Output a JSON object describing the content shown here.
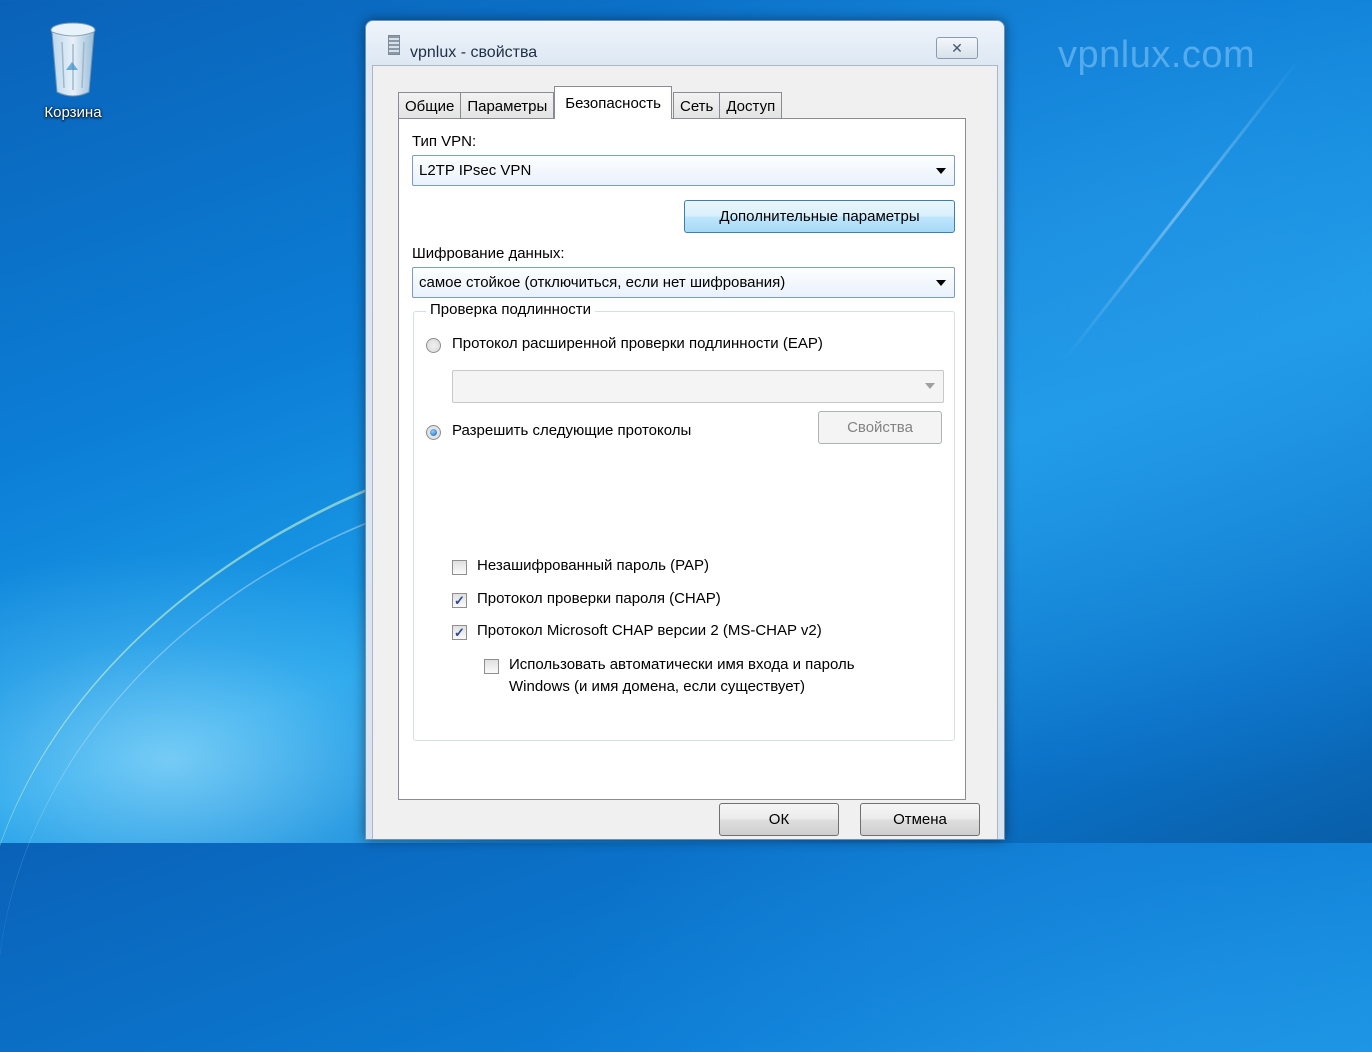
{
  "desktop": {
    "watermark": "vpnlux.com",
    "recycle_bin_label": "Корзина"
  },
  "window": {
    "title": "vpnlux - свойства",
    "close_glyph": "✕"
  },
  "tabs": [
    {
      "label": "Общие",
      "active": false
    },
    {
      "label": "Параметры",
      "active": false
    },
    {
      "label": "Безопасность",
      "active": true
    },
    {
      "label": "Сеть",
      "active": false
    },
    {
      "label": "Доступ",
      "active": false
    }
  ],
  "security": {
    "vpn_type_label": "Тип VPN:",
    "vpn_type_value": "L2TP IPsec VPN",
    "advanced_button": "Дополнительные параметры",
    "encryption_label": "Шифрование данных:",
    "encryption_value": "самое стойкое (отключиться, если нет шифрования)",
    "auth": {
      "group_title": "Проверка подлинности",
      "eap_label": "Протокол расширенной проверки подлинности (EAP)",
      "eap_selected": false,
      "eap_combo_value": "",
      "allow_label": "Разрешить следующие протоколы",
      "allow_selected": true,
      "properties_button": "Свойства",
      "protocols": [
        {
          "label": "Незашифрованный пароль (PAP)",
          "checked": false
        },
        {
          "label": "Протокол проверки пароля (CHAP)",
          "checked": true
        },
        {
          "label": "Протокол Microsoft CHAP версии 2 (MS-CHAP v2)",
          "checked": true
        }
      ],
      "auto_logon_line1": "Использовать автоматически имя входа и пароль",
      "auto_logon_line2": "Windows (и имя домена, если существует)",
      "auto_logon_checked": false
    }
  },
  "footer": {
    "ok_label": "ОК",
    "cancel_label": "Отмена"
  },
  "colors": {
    "desktop_blue": "#0c7ed6",
    "accent_radio": "#1461b4",
    "check_mark": "#2a4b94"
  }
}
